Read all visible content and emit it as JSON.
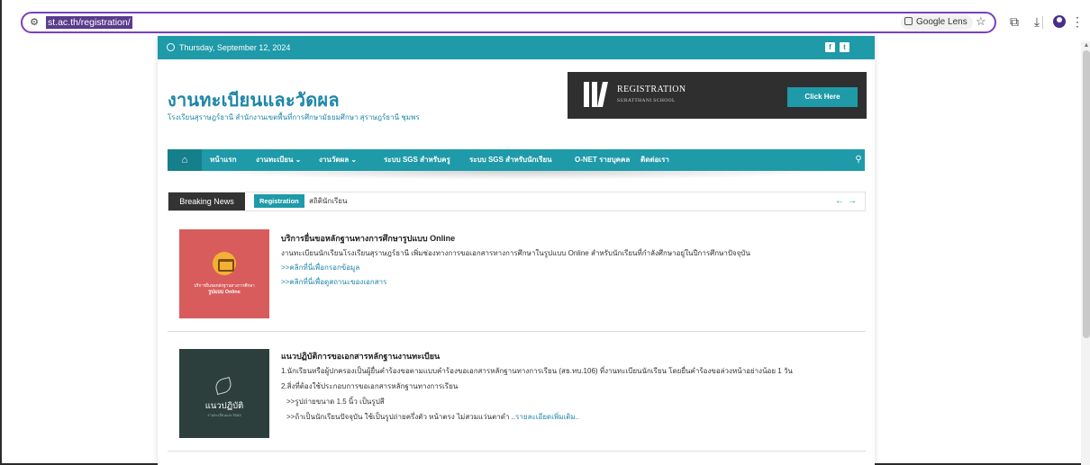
{
  "browser": {
    "url": "st.ac.th/registration/",
    "lens_label": "Google Lens"
  },
  "page": {
    "date": "Thursday, September 12, 2024",
    "social": [
      "f",
      "t"
    ],
    "site_title": "งานทะเบียนและวัดผล",
    "site_subtitle": "โรงเรียนสุราษฎร์ธานี สำนักงานเขตพื้นที่การศึกษามัธยมศึกษา สุราษฎร์ธานี ชุมพร",
    "banner": {
      "title": "REGISTRATION",
      "subtitle": "SURATTHANI SCHOOL",
      "button": "Click Here"
    },
    "nav": {
      "items": [
        "หน้าแรก",
        "งานทะเบียน ⌄",
        "งานวัดผล ⌄",
        "ระบบ SGS สำหรับครู",
        "ระบบ SGS สำหรับนักเรียน",
        "O-NET รายบุคคล",
        "ติดต่อเรา"
      ]
    },
    "news": {
      "label": "Breaking News",
      "tag": "Registration",
      "text": "สถิตินักเรียน",
      "prev": "←",
      "next": "→"
    },
    "posts": [
      {
        "title": "บริการยื่นขอหลักฐานทางการศึกษารูปแบบ Online",
        "text": "งานทะเบียนนักเรียนโรงเรียนสุราษฎร์ธานี เพิ่มช่องทางการขอเอกสารทางการศึกษาในรูปแบบ Online  สำหรับนักเรียนที่กำลังศึกษาอยู่ในปีการศึกษาปัจจุบัน",
        "links": [
          ">>คลิกที่นี่เพื่อกรอกข้อมูล",
          ">>คลิกที่นี่เพื่อดูสถานะของเอกสาร"
        ],
        "thumb_caption": "บริการยื่นขอหลักฐานทางการศึกษา",
        "thumb_caption2": "รูปแบบ Online"
      },
      {
        "title": "แนวปฏิบัติการขอเอกสารหลักฐานงานทะเบียน",
        "lines": [
          "1.นักเรียนหรือผู้ปกครองเป็นผู้ยื่นคำร้องขอตามแบบคำร้องขอเอกสารหลักฐานทางการเรียน (สธ.ทบ.106) ที่งานทะเบียนนักเรียน โดยยื่นคำร้องขอล่วงหน้าอย่างน้อย 1 วัน",
          "2.สิ่งที่ต้องใช้ประกอบการขอเอกสารหลักฐานทางการเรียน",
          ">>รูปถ่ายขนาด 1.5 นิ้ว เป็นรูปสี",
          ">>ถ้าเป็นนักเรียนปัจจุบัน ใช้เป็นรูปถ่ายครึ่งตัว หน้าตรง ไม่สวมแว่นตาดำ .."
        ],
        "more_link": "รายละเอียดเพิ่มเติม..",
        "thumb_word": "แนวปฏิบัติ",
        "thumb_mini": "งานทะเบียนและวัดผล"
      }
    ]
  }
}
